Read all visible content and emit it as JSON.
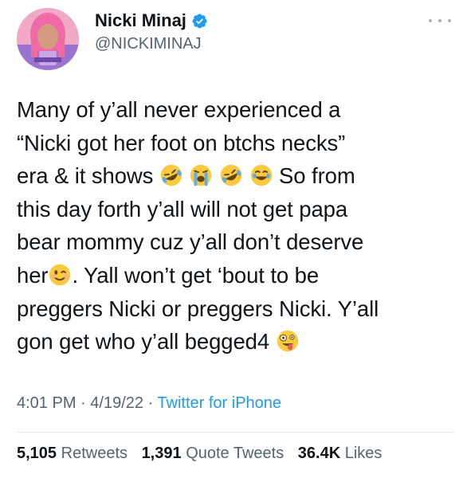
{
  "author": {
    "display_name": "Nicki Minaj",
    "handle": "@NICKIMINAJ",
    "verified_icon": "verified-badge-icon",
    "verified_color": "#1d9bf0"
  },
  "tweet": {
    "lines": [
      "Many of y’all never experienced a",
      "“Nicki got her foot on btchs necks”",
      "era & it shows",
      "So from",
      "this day forth y’all will not get papa",
      "bear mommy cuz y’all don’t deserve",
      "her",
      ". Yall won’t get ‘bout to be",
      "preggers Nicki or preggers Nicki. Y’all",
      "gon get who y’all begged4"
    ],
    "emojis": [
      "rofl-emoji",
      "loudly-crying-emoji",
      "rofl-emoji",
      "joy-emoji",
      "winking-emoji",
      "zany-emoji"
    ]
  },
  "meta": {
    "time": "4:01 PM",
    "sep1": " · ",
    "date": "4/19/22",
    "sep2": " · ",
    "source": "Twitter for iPhone"
  },
  "stats": {
    "retweets_count": "5,105",
    "retweets_label": "Retweets",
    "quotes_count": "1,391",
    "quotes_label": "Quote Tweets",
    "likes_count": "36.4K",
    "likes_label": "Likes"
  },
  "colors": {
    "text": "#0f1419",
    "secondary": "#536471",
    "link": "#1d9bf0",
    "divider": "#dfe4e8"
  }
}
